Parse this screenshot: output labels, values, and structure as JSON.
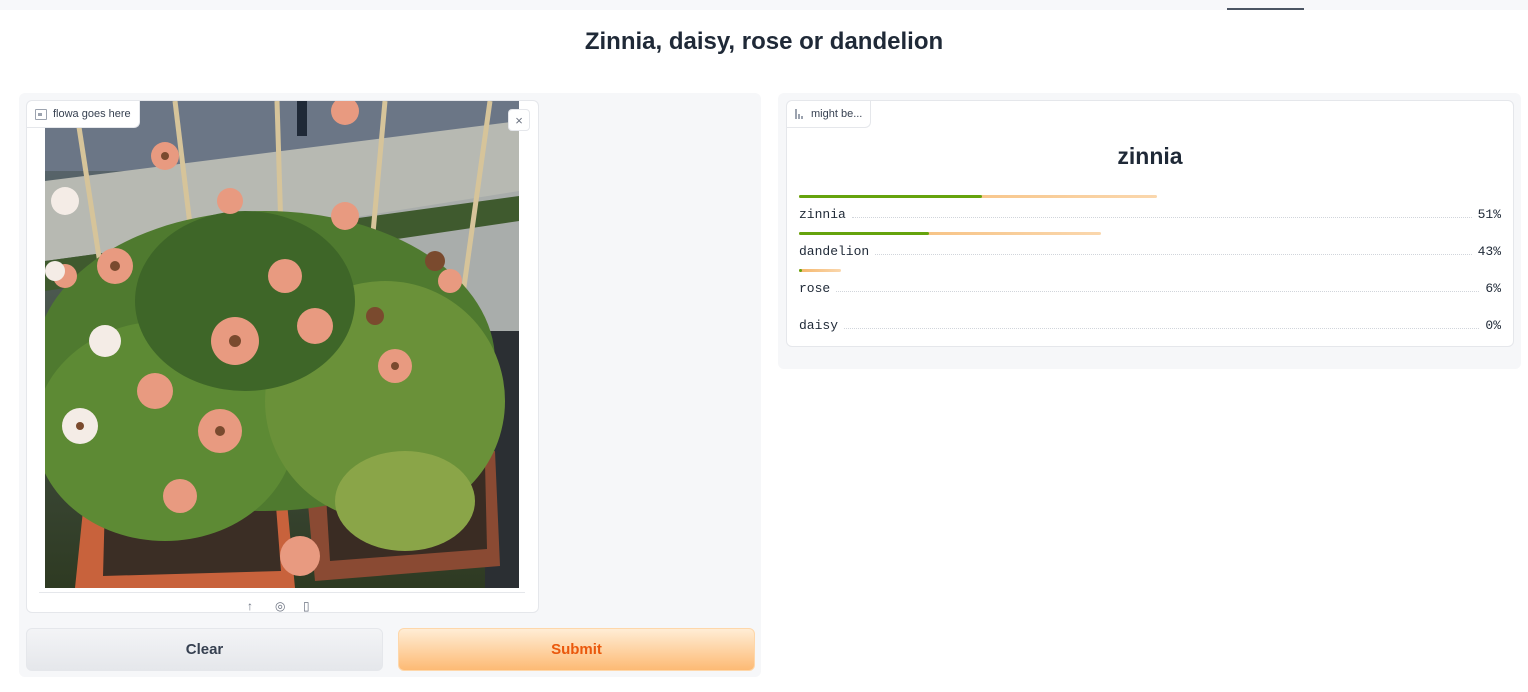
{
  "header": {
    "title": "Zinnia, daisy, rose or dandelion"
  },
  "input": {
    "label": "flowa goes here",
    "close_symbol": "×",
    "tools": [
      "upload-icon",
      "webcam-icon",
      "clipboard-icon"
    ]
  },
  "buttons": {
    "clear": "Clear",
    "submit": "Submit"
  },
  "output": {
    "label": "might be...",
    "top_prediction": "zinnia",
    "confidences": [
      {
        "label": "zinnia",
        "percent": "51%",
        "value": 0.51
      },
      {
        "label": "dandelion",
        "percent": "43%",
        "value": 0.43
      },
      {
        "label": "rose",
        "percent": "6%",
        "value": 0.06
      },
      {
        "label": "daisy",
        "percent": "0%",
        "value": 0.0
      }
    ]
  },
  "colors": {
    "accent": "#ea580c",
    "bar_green": "#65a30d",
    "bar_orange": "#f5b66b"
  }
}
